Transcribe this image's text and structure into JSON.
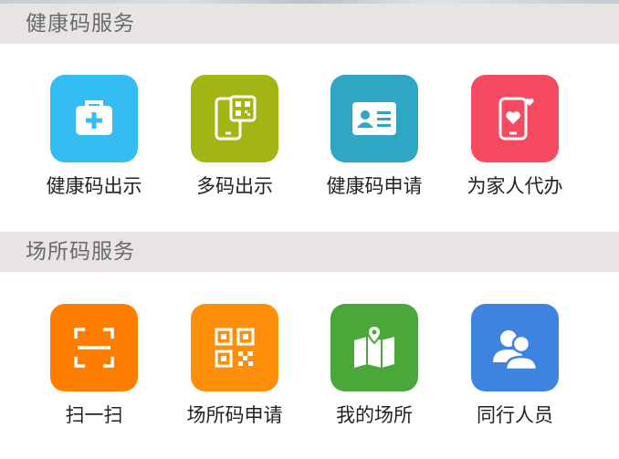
{
  "health_section": {
    "title": "健康码服务",
    "items": [
      {
        "label": "健康码出示",
        "icon": "medical-kit-icon",
        "color": "#33bdf2"
      },
      {
        "label": "多码出示",
        "icon": "phone-qr-icon",
        "color": "#a3b512"
      },
      {
        "label": "健康码申请",
        "icon": "id-card-icon",
        "color": "#2ea6c4"
      },
      {
        "label": "为家人代办",
        "icon": "phone-heart-icon",
        "color": "#f54a60"
      }
    ]
  },
  "venue_section": {
    "title": "场所码服务",
    "items": [
      {
        "label": "扫一扫",
        "icon": "scan-icon",
        "color": "#ff7e00"
      },
      {
        "label": "场所码申请",
        "icon": "qr-code-icon",
        "color": "#ff8f0a"
      },
      {
        "label": "我的场所",
        "icon": "map-pin-icon",
        "color": "#4aa83a"
      },
      {
        "label": "同行人员",
        "icon": "people-icon",
        "color": "#3f83e0"
      }
    ]
  }
}
